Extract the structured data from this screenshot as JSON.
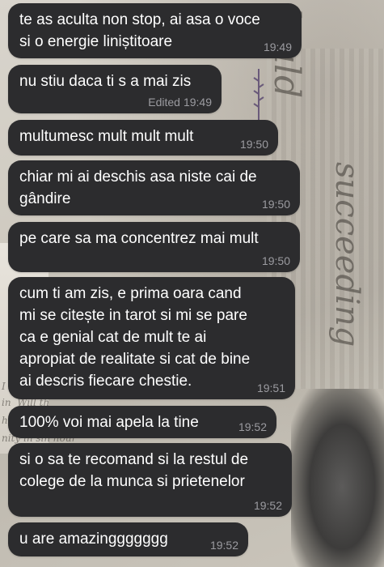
{
  "chat": {
    "messages": [
      {
        "text": "te as aculta non stop, ai asa o voce\nsi o energie liniștitoare",
        "time": "19:49",
        "edited": ""
      },
      {
        "text": "nu stiu daca ti s a mai zis",
        "time": "19:49",
        "edited": "Edited"
      },
      {
        "text": "multumesc mult mult mult",
        "time": "19:50",
        "edited": ""
      },
      {
        "text": "chiar mi ai deschis asa niste cai de\ngândire",
        "time": "19:50",
        "edited": ""
      },
      {
        "text": "pe care sa ma concentrez mai mult",
        "time": "19:50",
        "edited": ""
      },
      {
        "text": "cum ti am zis, e prima oara cand\nmi se citește in tarot si mi se pare\nca e genial cat de mult te ai\napropiat de realitate si cat de bine\nai descris fiecare chestie.",
        "time": "19:51",
        "edited": ""
      },
      {
        "text": "100% voi mai apela la tine",
        "time": "19:52",
        "edited": ""
      },
      {
        "text": "si o sa te recomand si la restul de\ncolege de la munca si prietenelor",
        "time": "19:52",
        "edited": ""
      },
      {
        "text": "u are amazinggggggg",
        "time": "19:52",
        "edited": ""
      }
    ]
  },
  "theme": {
    "bubble_bg": "#2c2c2e",
    "bubble_text": "#ffffff",
    "meta_text": "#9b9ba0"
  }
}
